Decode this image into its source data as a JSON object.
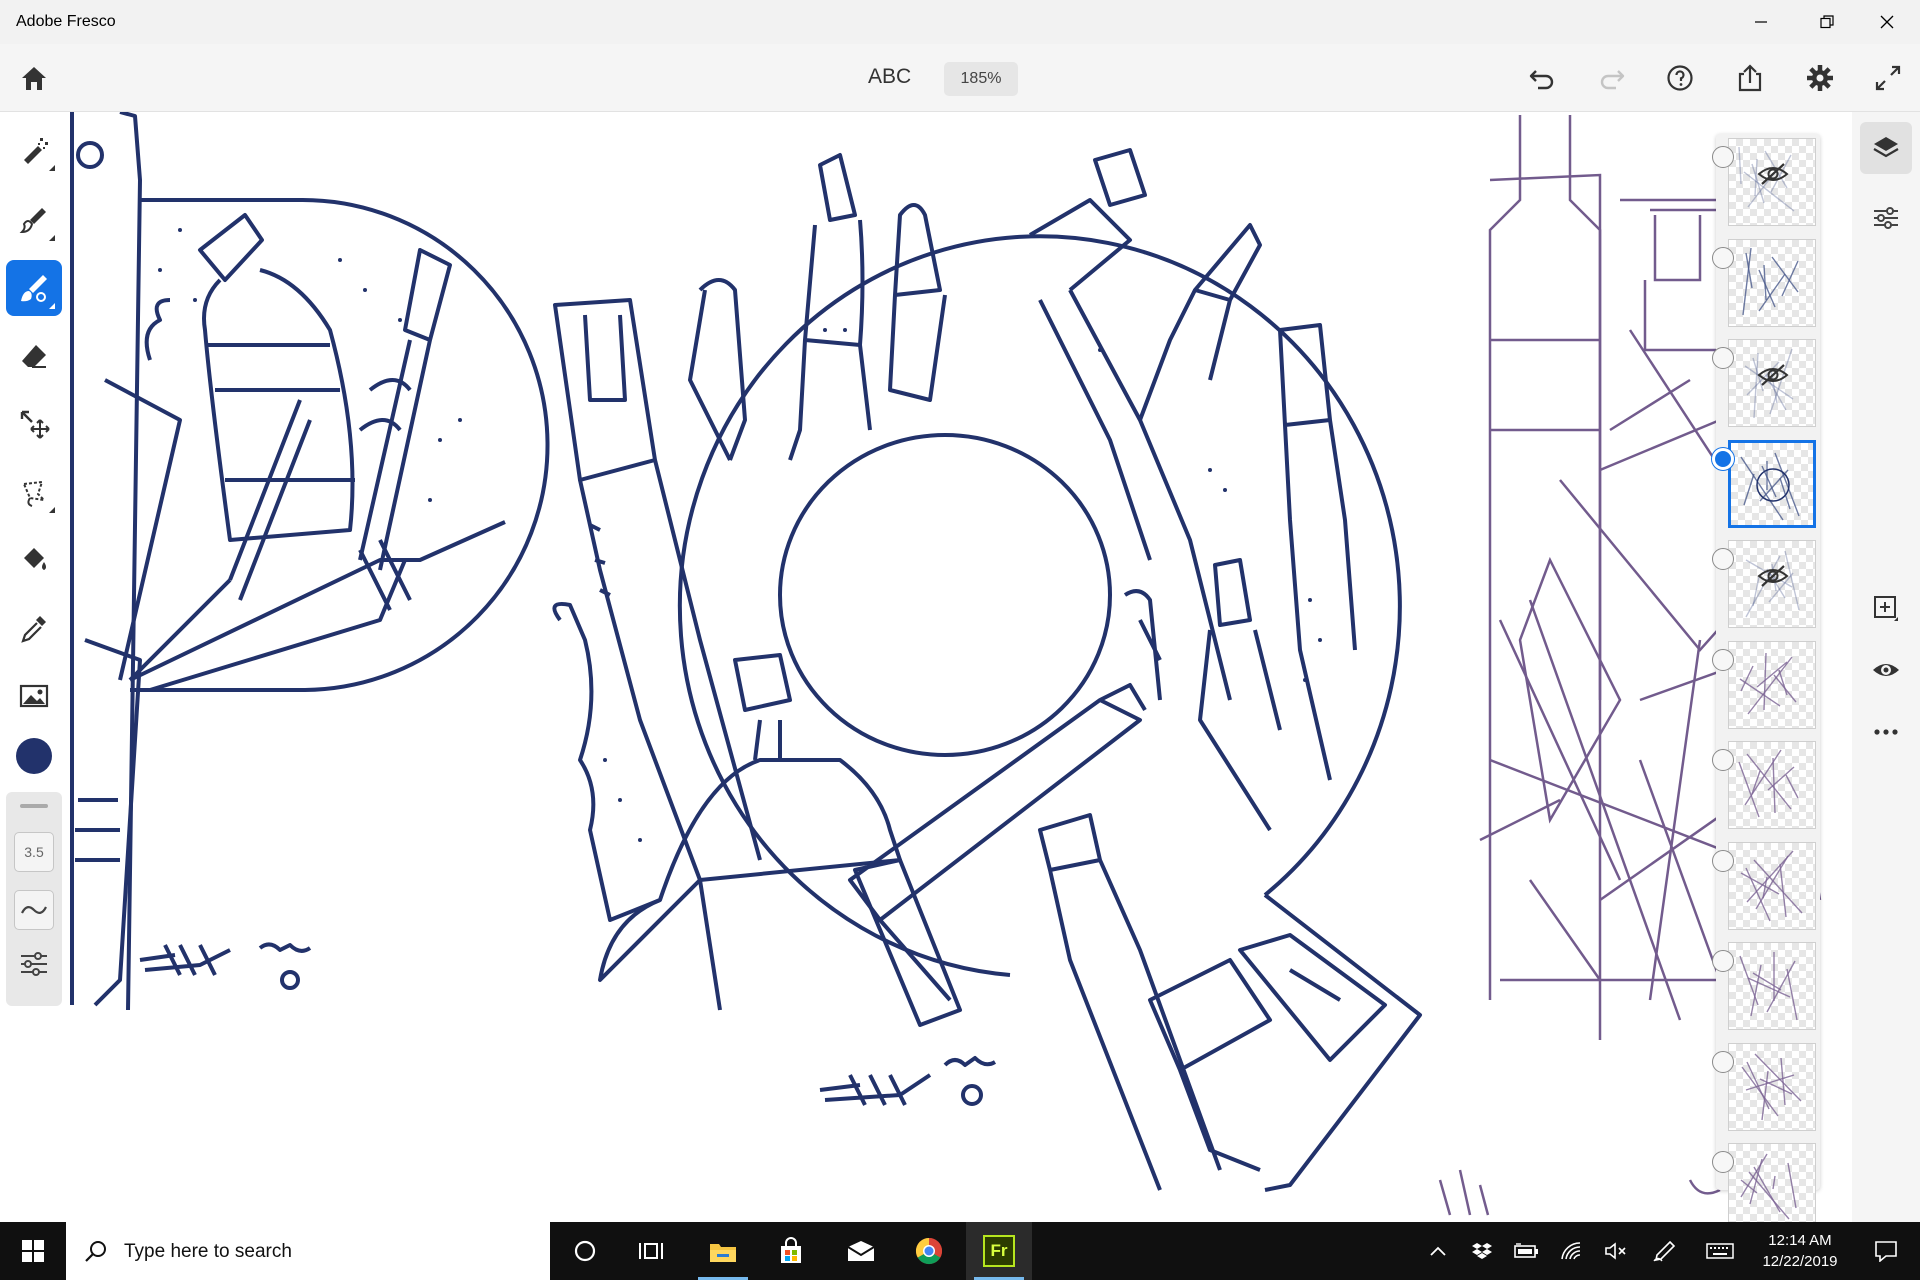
{
  "window": {
    "title": "Adobe Fresco"
  },
  "appbar": {
    "document_title": "ABC",
    "zoom": "185%"
  },
  "toolbar": {
    "brush_size": "3.5",
    "color": "#22326b"
  },
  "colors": {
    "accent": "#1473e6",
    "ink": "#22326b",
    "sketch": "#5a3f7a"
  },
  "layers": {
    "items": [
      {
        "hidden": true,
        "selected": false
      },
      {
        "hidden": false,
        "selected": false
      },
      {
        "hidden": true,
        "selected": false
      },
      {
        "hidden": false,
        "selected": true
      },
      {
        "hidden": true,
        "selected": false
      },
      {
        "hidden": false,
        "selected": false
      },
      {
        "hidden": false,
        "selected": false
      },
      {
        "hidden": false,
        "selected": false
      },
      {
        "hidden": false,
        "selected": false
      },
      {
        "hidden": false,
        "selected": false
      },
      {
        "hidden": false,
        "selected": false
      }
    ]
  },
  "taskbar": {
    "search_placeholder": "Type here to search",
    "time": "12:14 AM",
    "date": "12/22/2019",
    "pinned_apps": [
      "cortana-icon",
      "task-view-icon",
      "file-explorer-icon",
      "store-icon",
      "mail-icon",
      "chrome-icon",
      "fresco-icon"
    ],
    "fresco_label": "Fr"
  }
}
